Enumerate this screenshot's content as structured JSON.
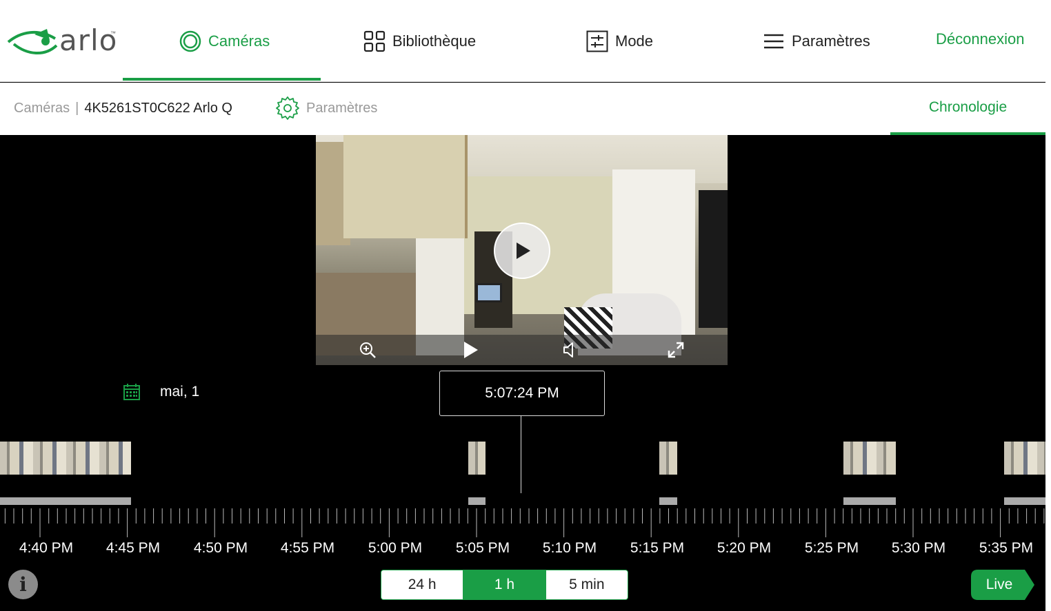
{
  "colors": {
    "accent": "#1a9e46",
    "background": "#000000",
    "clip_bar": "#aaaaaa"
  },
  "brand": {
    "logo_text": "arlo",
    "trademark": "™"
  },
  "nav": {
    "items": [
      {
        "label": "Caméras",
        "icon": "camera-ring-icon",
        "active": true
      },
      {
        "label": "Bibliothèque",
        "icon": "grid-icon",
        "active": false
      },
      {
        "label": "Mode",
        "icon": "sliders-icon",
        "active": false
      },
      {
        "label": "Paramètres",
        "icon": "menu-icon",
        "active": false
      }
    ],
    "logout": "Déconnexion"
  },
  "subnav": {
    "breadcrumb_root": "Caméras",
    "separator": "|",
    "camera_name": "4K5261ST0C622 Arlo Q",
    "settings_label": "Paramètres",
    "timeline_tab": "Chronologie"
  },
  "player": {
    "icons": [
      "zoom-in-icon",
      "play-icon",
      "volume-icon",
      "expand-icon"
    ]
  },
  "timeline": {
    "date": "mai, 1",
    "current_time": "5:07:24 PM",
    "tick_labels": [
      "4:40 PM",
      "4:45 PM",
      "4:50 PM",
      "4:55 PM",
      "5:00 PM",
      "5:05 PM",
      "5:10 PM",
      "5:15 PM",
      "5:20 PM",
      "5:25 PM",
      "5:30 PM",
      "5:35 PM"
    ],
    "zoom_options": [
      "24 h",
      "1 h",
      "5 min"
    ],
    "zoom_selected": "1 h",
    "live_label": "Live",
    "info_label": "i"
  }
}
